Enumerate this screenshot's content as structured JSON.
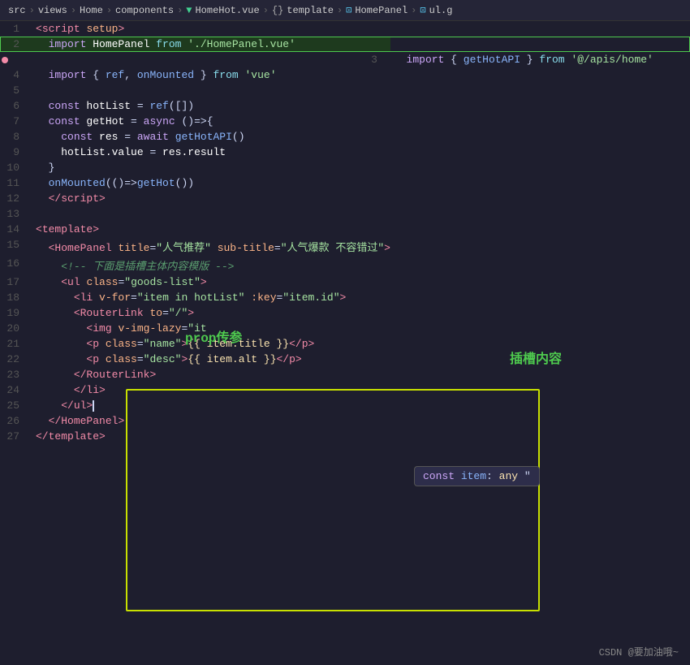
{
  "breadcrumb": {
    "parts": [
      "src",
      "views",
      "Home",
      "components",
      "HomeHot.vue",
      "template",
      "HomePanel",
      "ul.g"
    ]
  },
  "code": {
    "lines": [
      {
        "num": 1,
        "tokens": [
          {
            "t": "<",
            "c": "tag"
          },
          {
            "t": "script",
            "c": "tag"
          },
          {
            "t": " ",
            "c": ""
          },
          {
            "t": "setup",
            "c": "attr"
          },
          {
            "t": ">",
            "c": "tag"
          }
        ]
      },
      {
        "num": 2,
        "tokens": [
          {
            "t": "  import ",
            "c": "kw"
          },
          {
            "t": "HomePanel",
            "c": "white"
          },
          {
            "t": " from ",
            "c": "cyan"
          },
          {
            "t": "'./HomePanel.vue'",
            "c": "str"
          }
        ],
        "highlighted": true
      },
      {
        "num": 3,
        "tokens": [
          {
            "t": "  import ",
            "c": "kw"
          },
          {
            "t": "{ ",
            "c": "punc"
          },
          {
            "t": "getHotAPI",
            "c": "fn"
          },
          {
            "t": " } ",
            "c": "punc"
          },
          {
            "t": "from",
            "c": "cyan"
          },
          {
            "t": " ",
            "c": ""
          },
          {
            "t": "'@/apis/home'",
            "c": "str"
          }
        ],
        "errorDot": true
      },
      {
        "num": 4,
        "tokens": [
          {
            "t": "  import ",
            "c": "kw"
          },
          {
            "t": "{ ",
            "c": "punc"
          },
          {
            "t": "ref",
            "c": "fn"
          },
          {
            "t": ", ",
            "c": "punc"
          },
          {
            "t": "onMounted",
            "c": "fn"
          },
          {
            "t": " } ",
            "c": "punc"
          },
          {
            "t": "from",
            "c": "cyan"
          },
          {
            "t": " ",
            "c": ""
          },
          {
            "t": "'vue'",
            "c": "str"
          }
        ]
      },
      {
        "num": 5,
        "tokens": []
      },
      {
        "num": 6,
        "tokens": [
          {
            "t": "  ",
            "c": ""
          },
          {
            "t": "const",
            "c": "kw"
          },
          {
            "t": " hotList ",
            "c": "white"
          },
          {
            "t": "=",
            "c": "punc"
          },
          {
            "t": " ref",
            "c": "fn"
          },
          {
            "t": "(",
            "c": "punc"
          },
          {
            "t": "[]",
            "c": "punc"
          },
          {
            "t": ")",
            "c": "punc"
          }
        ]
      },
      {
        "num": 7,
        "tokens": [
          {
            "t": "  ",
            "c": ""
          },
          {
            "t": "const",
            "c": "kw"
          },
          {
            "t": " getHot ",
            "c": "white"
          },
          {
            "t": "=",
            "c": "punc"
          },
          {
            "t": " ",
            "c": ""
          },
          {
            "t": "async",
            "c": "kw"
          },
          {
            "t": " ()=>",
            "c": "punc"
          },
          {
            "t": "{",
            "c": "punc"
          }
        ]
      },
      {
        "num": 8,
        "tokens": [
          {
            "t": "    ",
            "c": ""
          },
          {
            "t": "const",
            "c": "kw"
          },
          {
            "t": " res ",
            "c": "white"
          },
          {
            "t": "=",
            "c": "punc"
          },
          {
            "t": " ",
            "c": ""
          },
          {
            "t": "await",
            "c": "kw"
          },
          {
            "t": " getHotAPI",
            "c": "fn"
          },
          {
            "t": "()",
            "c": "punc"
          }
        ]
      },
      {
        "num": 9,
        "tokens": [
          {
            "t": "    hotList",
            "c": "white"
          },
          {
            "t": ".value ",
            "c": "white"
          },
          {
            "t": "=",
            "c": "punc"
          },
          {
            "t": " res",
            "c": "white"
          },
          {
            "t": ".result",
            "c": "white"
          }
        ]
      },
      {
        "num": 10,
        "tokens": [
          {
            "t": "  }",
            "c": "punc"
          }
        ]
      },
      {
        "num": 11,
        "tokens": [
          {
            "t": "  ",
            "c": ""
          },
          {
            "t": "onMounted",
            "c": "fn"
          },
          {
            "t": "(()=>",
            "c": "punc"
          },
          {
            "t": "getHot",
            "c": "fn"
          },
          {
            "t": "())",
            "c": "punc"
          }
        ]
      },
      {
        "num": 12,
        "tokens": [
          {
            "t": "  ",
            "c": ""
          },
          {
            "t": "</",
            "c": "tag"
          },
          {
            "t": "script",
            "c": "tag"
          },
          {
            "t": ">",
            "c": "tag"
          }
        ]
      },
      {
        "num": 13,
        "tokens": []
      },
      {
        "num": 14,
        "tokens": [
          {
            "t": "<",
            "c": "tag"
          },
          {
            "t": "template",
            "c": "tag"
          },
          {
            "t": ">",
            "c": "tag"
          }
        ]
      },
      {
        "num": 15,
        "tokens": [
          {
            "t": "  ",
            "c": ""
          },
          {
            "t": "<",
            "c": "tag"
          },
          {
            "t": "HomePanel",
            "c": "tag"
          },
          {
            "t": " ",
            "c": ""
          },
          {
            "t": "title",
            "c": "attr"
          },
          {
            "t": "=",
            "c": "punc"
          },
          {
            "t": "\"人气推荐\"",
            "c": "str"
          },
          {
            "t": " ",
            "c": ""
          },
          {
            "t": "sub-title",
            "c": "attr"
          },
          {
            "t": "=",
            "c": "punc"
          },
          {
            "t": "\"人气爆款 不容错过\"",
            "c": "str"
          },
          {
            "t": ">",
            "c": "tag"
          }
        ]
      },
      {
        "num": 16,
        "tokens": [
          {
            "t": "    ",
            "c": ""
          },
          {
            "t": "<!-- ",
            "c": "comment2"
          },
          {
            "t": "下面是插槽主体内容模版",
            "c": "comment2"
          },
          {
            "t": " -->",
            "c": "comment2"
          }
        ]
      },
      {
        "num": 17,
        "tokens": [
          {
            "t": "    ",
            "c": ""
          },
          {
            "t": "<ul ",
            "c": "tag"
          },
          {
            "t": "class",
            "c": "attr"
          },
          {
            "t": "=",
            "c": "punc"
          },
          {
            "t": "\"goods-list\"",
            "c": "str"
          },
          {
            "t": ">",
            "c": "tag"
          }
        ]
      },
      {
        "num": 18,
        "tokens": [
          {
            "t": "      ",
            "c": ""
          },
          {
            "t": "<li ",
            "c": "tag"
          },
          {
            "t": "v-for",
            "c": "attr"
          },
          {
            "t": "=",
            "c": "punc"
          },
          {
            "t": "\"item in hotList\"",
            "c": "str"
          },
          {
            "t": " ",
            "c": ""
          },
          {
            "t": ":key",
            "c": "attr"
          },
          {
            "t": "=",
            "c": "punc"
          },
          {
            "t": "\"item.id\"",
            "c": "str"
          },
          {
            "t": ">",
            "c": "tag"
          }
        ]
      },
      {
        "num": 19,
        "tokens": [
          {
            "t": "      ",
            "c": ""
          },
          {
            "t": "<",
            "c": "tag"
          },
          {
            "t": "RouterLink",
            "c": "tag"
          },
          {
            "t": " ",
            "c": ""
          },
          {
            "t": "to",
            "c": "attr"
          },
          {
            "t": "=",
            "c": "punc"
          },
          {
            "t": "\"/\"",
            "c": "str"
          },
          {
            "t": ">",
            "c": "tag"
          }
        ]
      },
      {
        "num": 20,
        "tokens": [
          {
            "t": "        ",
            "c": ""
          },
          {
            "t": "<img ",
            "c": "tag"
          },
          {
            "t": "v-img-lazy",
            "c": "attr"
          },
          {
            "t": "=",
            "c": "punc"
          },
          {
            "t": "\"it",
            "c": "str"
          }
        ]
      },
      {
        "num": 21,
        "tokens": [
          {
            "t": "        ",
            "c": ""
          },
          {
            "t": "<p ",
            "c": "tag"
          },
          {
            "t": "class",
            "c": "attr"
          },
          {
            "t": "=",
            "c": "punc"
          },
          {
            "t": "\"name\"",
            "c": "str"
          },
          {
            "t": ">",
            "c": "tag"
          },
          {
            "t": "{{ item.title }}",
            "c": "yellow"
          },
          {
            "t": "</p>",
            "c": "tag"
          }
        ]
      },
      {
        "num": 22,
        "tokens": [
          {
            "t": "        ",
            "c": ""
          },
          {
            "t": "<p ",
            "c": "tag"
          },
          {
            "t": "class",
            "c": "attr"
          },
          {
            "t": "=",
            "c": "punc"
          },
          {
            "t": "\"desc\"",
            "c": "str"
          },
          {
            "t": ">",
            "c": "tag"
          },
          {
            "t": "{{ item.alt }}",
            "c": "yellow"
          },
          {
            "t": "</p>",
            "c": "tag"
          }
        ]
      },
      {
        "num": 23,
        "tokens": [
          {
            "t": "      ",
            "c": ""
          },
          {
            "t": "</",
            "c": "tag"
          },
          {
            "t": "RouterLink",
            "c": "tag"
          },
          {
            "t": ">",
            "c": "tag"
          }
        ]
      },
      {
        "num": 24,
        "tokens": [
          {
            "t": "      ",
            "c": ""
          },
          {
            "t": "</li>",
            "c": "tag"
          }
        ]
      },
      {
        "num": 25,
        "tokens": [
          {
            "t": "    ",
            "c": ""
          },
          {
            "t": "</ul>",
            "c": "tag"
          },
          {
            "t": "▌",
            "c": "cursor"
          }
        ],
        "cursor": true
      },
      {
        "num": 26,
        "tokens": [
          {
            "t": "  ",
            "c": ""
          },
          {
            "t": "</",
            "c": "tag"
          },
          {
            "t": "HomePanel",
            "c": "tag"
          },
          {
            "t": ">",
            "c": "tag"
          }
        ]
      },
      {
        "num": 27,
        "tokens": [
          {
            "t": "</",
            "c": "tag"
          },
          {
            "t": "template",
            "c": "tag"
          },
          {
            "t": ">",
            "c": "tag"
          }
        ]
      }
    ]
  },
  "annotations": {
    "prop": "prop传参",
    "slot": "插槽内容"
  },
  "tooltip": {
    "text": "const item: any \""
  },
  "footer": "CSDN @要加油哦~"
}
